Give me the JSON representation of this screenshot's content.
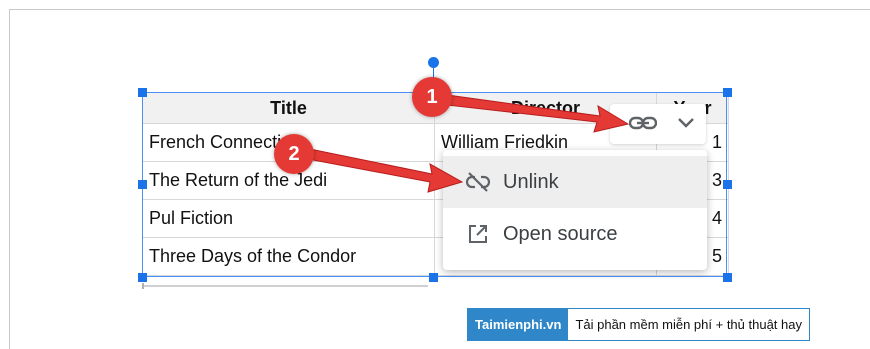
{
  "table": {
    "headers": [
      "Title",
      "Director",
      "Year"
    ],
    "rows": [
      {
        "title": "French Connection",
        "director": "William Friedkin",
        "year": "1"
      },
      {
        "title": "The Return of the Jedi",
        "director": "",
        "year": "3"
      },
      {
        "title": "Pul Fiction",
        "director": "",
        "year": "4"
      },
      {
        "title": "Three Days of the Condor",
        "director": "",
        "year": "5"
      }
    ]
  },
  "link_chip": {
    "icons": [
      "link-icon",
      "chevron-down-icon"
    ]
  },
  "menu": {
    "items": [
      {
        "label": "Unlink",
        "icon": "unlink-icon"
      },
      {
        "label": "Open source",
        "icon": "open-in-new-icon"
      }
    ]
  },
  "annotations": {
    "badge1": "1",
    "badge2": "2",
    "color": "#e53935"
  },
  "watermark": {
    "brand": "Taimienphi.vn",
    "tagline": "Tải phần mềm miễn phí + thủ thuật hay",
    "color": "#2f86c8"
  }
}
